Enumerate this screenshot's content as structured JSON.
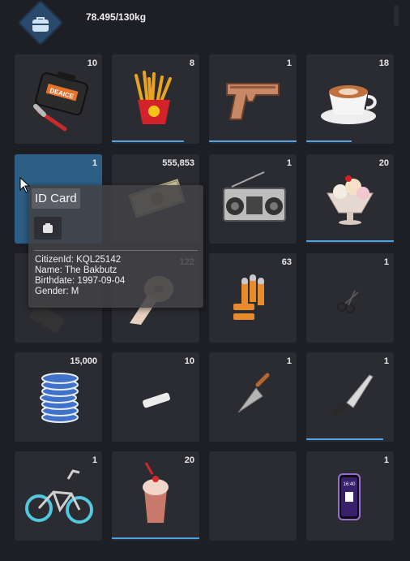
{
  "header": {
    "weight_text": "78.495/130kg",
    "bag_icon": "backpack-icon"
  },
  "slots": [
    {
      "name": "tool-case",
      "icon": "toolbox-icon",
      "count": "10",
      "art_text": "DEAICE"
    },
    {
      "name": "fries",
      "icon": "fries-icon",
      "count": "8",
      "progress": 0.82
    },
    {
      "name": "pistol",
      "icon": "pistol-icon",
      "count": "1",
      "progress": 1.0
    },
    {
      "name": "cappuccino",
      "icon": "coffee-cup-icon",
      "count": "18",
      "progress": 0.52
    },
    {
      "name": "id-card",
      "icon": "id-card-icon",
      "count": "1",
      "selected": true
    },
    {
      "name": "cash",
      "icon": "cash-icon",
      "count": "555,853"
    },
    {
      "name": "boombox",
      "icon": "radio-icon",
      "count": "1"
    },
    {
      "name": "ice-cream",
      "icon": "sundae-icon",
      "count": "20",
      "progress": 1.0
    },
    {
      "name": "phone-black",
      "icon": "keypad-phone-icon",
      "count": ""
    },
    {
      "name": "bandage",
      "icon": "bandage-roll-icon",
      "count": "122"
    },
    {
      "name": "ammo",
      "icon": "bullets-icon",
      "count": "63"
    },
    {
      "name": "scissors",
      "icon": "scissors-icon",
      "count": "1"
    },
    {
      "name": "casino-chips",
      "icon": "chip-stack-icon",
      "count": "15,000"
    },
    {
      "name": "chalk",
      "icon": "chalk-icon",
      "count": "10"
    },
    {
      "name": "trowel",
      "icon": "trowel-icon",
      "count": "1"
    },
    {
      "name": "knife",
      "icon": "knife-icon",
      "count": "1",
      "progress": 0.88
    },
    {
      "name": "bmx",
      "icon": "bicycle-icon",
      "count": "1"
    },
    {
      "name": "milkshake",
      "icon": "milkshake-icon",
      "count": "20",
      "progress": 1.0
    },
    {
      "name": "empty",
      "icon": "",
      "count": ""
    },
    {
      "name": "smartphone",
      "icon": "smartphone-icon",
      "count": "1",
      "screen_time": "16:40"
    }
  ],
  "tooltip": {
    "title": "ID Card",
    "lines": [
      "CitizenId: KQL25142",
      "Name: The Bakbutz",
      "Birthdate: 1997-09-04",
      "Gender: M"
    ]
  },
  "colors": {
    "background": "#1e1f24",
    "slot": "#2b2c31",
    "selected_slot": "#2d5f86",
    "progress": "#4da3e6"
  }
}
